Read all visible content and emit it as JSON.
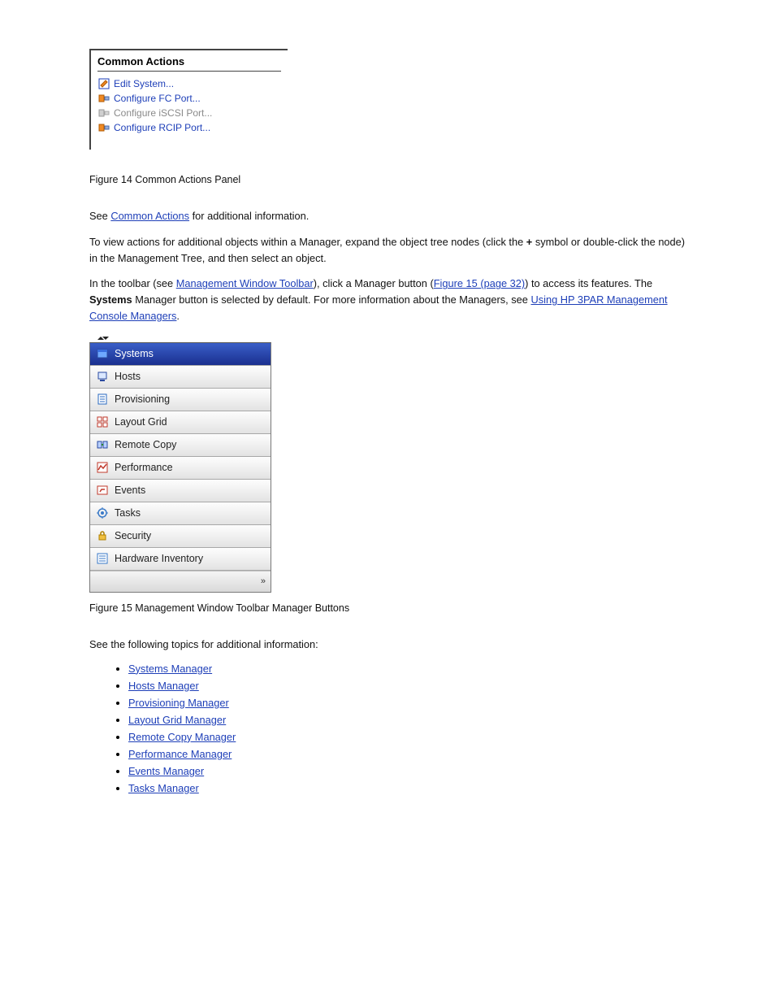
{
  "commonActions": {
    "title": "Common Actions",
    "items": [
      {
        "label": "Edit System...",
        "enabled": true,
        "icon": "edit-icon"
      },
      {
        "label": "Configure FC Port...",
        "enabled": true,
        "icon": "fc-port-icon"
      },
      {
        "label": "Configure iSCSI Port...",
        "enabled": false,
        "icon": "iscsi-port-icon"
      },
      {
        "label": "Configure RCIP Port...",
        "enabled": true,
        "icon": "rcip-port-icon"
      }
    ]
  },
  "figure14": {
    "caption": "Figure 14 Common Actions Panel"
  },
  "paragraphs": {
    "p1_a": "See ",
    "p1_link": "Common Actions",
    "p1_b": " for additional information.",
    "p2_a": "To view actions for additional objects within a Manager, expand the object tree nodes (click the ",
    "p2_plus": "+",
    "p2_b": " symbol or double-click the node) in the Management Tree, and then select an object.",
    "p3_a": "In the toolbar (see ",
    "p3_link1": "Management Window Toolbar",
    "p3_b": "), click a Manager button (",
    "p3_link2": "Figure 15 (page 32)",
    "p3_c": ") to access its features. The ",
    "p3_bold": "Systems",
    "p3_d": " Manager button is selected by default. For more information about the Managers, see ",
    "p3_link3": "Using HP 3PAR Management Console Managers",
    "p3_e": "."
  },
  "toolbar": {
    "items": [
      {
        "label": "Systems",
        "selected": true,
        "icon": "systems-icon"
      },
      {
        "label": "Hosts",
        "selected": false,
        "icon": "hosts-icon"
      },
      {
        "label": "Provisioning",
        "selected": false,
        "icon": "provisioning-icon"
      },
      {
        "label": "Layout Grid",
        "selected": false,
        "icon": "layout-grid-icon"
      },
      {
        "label": "Remote Copy",
        "selected": false,
        "icon": "remote-copy-icon"
      },
      {
        "label": "Performance",
        "selected": false,
        "icon": "performance-icon"
      },
      {
        "label": "Events",
        "selected": false,
        "icon": "events-icon"
      },
      {
        "label": "Tasks",
        "selected": false,
        "icon": "tasks-icon"
      },
      {
        "label": "Security",
        "selected": false,
        "icon": "security-icon"
      },
      {
        "label": "Hardware Inventory",
        "selected": false,
        "icon": "hardware-inventory-icon"
      }
    ]
  },
  "figure15": {
    "caption": "Figure 15 Management Window Toolbar Manager Buttons"
  },
  "listIntro": "See the following topics for additional information:",
  "bullets": [
    "Systems Manager",
    "Hosts Manager",
    "Provisioning Manager",
    "Layout Grid Manager",
    "Remote Copy Manager",
    "Performance Manager",
    "Events Manager",
    "Tasks Manager"
  ]
}
